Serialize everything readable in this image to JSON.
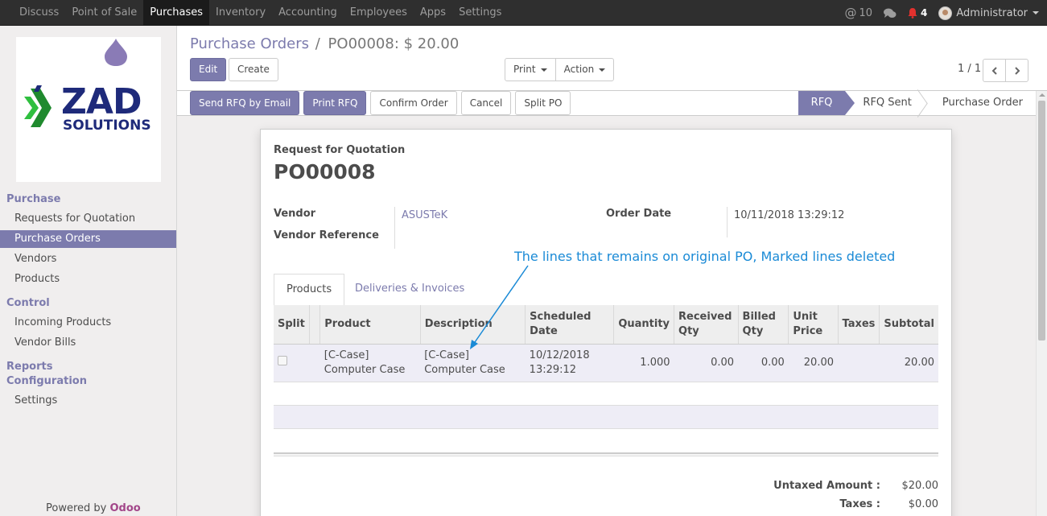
{
  "topnav": {
    "menu": [
      "Discuss",
      "Point of Sale",
      "Purchases",
      "Inventory",
      "Accounting",
      "Employees",
      "Apps",
      "Settings"
    ],
    "active_index": 2,
    "messages_count": "10",
    "notifications_count": "4",
    "user": "Administrator",
    "at_icon": "@"
  },
  "sidebar": {
    "logo_text_main": "ZAD",
    "logo_text_sub": "SOLUTIONS",
    "sections": [
      {
        "title": "Purchase",
        "items": [
          "Requests for Quotation",
          "Purchase Orders",
          "Vendors",
          "Products"
        ]
      },
      {
        "title": "Control",
        "items": [
          "Incoming Products",
          "Vendor Bills"
        ]
      },
      {
        "title": "Reports",
        "items": []
      },
      {
        "title": "Configuration",
        "items": [
          "Settings"
        ]
      }
    ],
    "active_item": "Purchase Orders",
    "powered_by": "Powered by",
    "powered_brand": "Odoo"
  },
  "control_panel": {
    "breadcrumb_parent": "Purchase Orders",
    "breadcrumb_sep": "/",
    "breadcrumb_current": "PO00008: $ 20.00",
    "edit_label": "Edit",
    "create_label": "Create",
    "print_label": "Print",
    "action_label": "Action",
    "pager": "1 / 1"
  },
  "statusbar": {
    "buttons": [
      "Send RFQ by Email",
      "Print RFQ",
      "Confirm Order",
      "Cancel",
      "Split PO"
    ],
    "stages": [
      "RFQ",
      "RFQ Sent",
      "Purchase Order"
    ],
    "current_stage": "RFQ"
  },
  "form": {
    "doc_type": "Request for Quotation",
    "doc_name": "PO00008",
    "vendor_label": "Vendor",
    "vendor_value": "ASUSTeK",
    "vendor_ref_label": "Vendor Reference",
    "vendor_ref_value": "",
    "order_date_label": "Order Date",
    "order_date_value": "10/11/2018 13:29:12",
    "tabs": [
      "Products",
      "Deliveries & Invoices"
    ],
    "active_tab": "Products",
    "columns": [
      "Split",
      "",
      "Product",
      "Description",
      "Scheduled Date",
      "Quantity",
      "Received Qty",
      "Billed Qty",
      "Unit Price",
      "Taxes",
      "Subtotal"
    ],
    "lines": [
      {
        "product": "[C-Case] Computer Case",
        "description": "[C-Case] Computer Case",
        "scheduled_date": "10/12/2018 13:29:12",
        "quantity": "1.000",
        "received_qty": "0.00",
        "billed_qty": "0.00",
        "unit_price": "20.00",
        "taxes": "",
        "subtotal": "20.00"
      }
    ],
    "untaxed_label": "Untaxed Amount :",
    "untaxed_value": "$20.00",
    "taxes_label": "Taxes :",
    "taxes_value": "$0.00"
  },
  "annotation": "The lines that remains on original PO, Marked lines deleted"
}
